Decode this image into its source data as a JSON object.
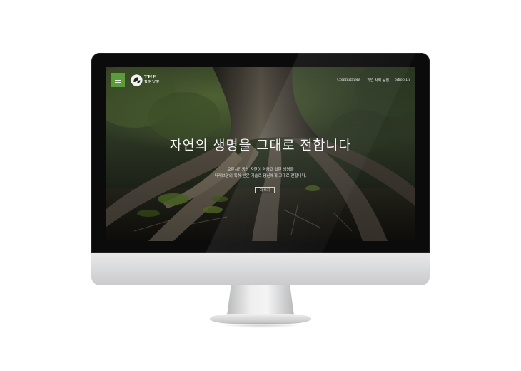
{
  "site": {
    "logo": {
      "line1": "THE",
      "line2": "REVE"
    },
    "nav": [
      "Commitment",
      "기업 사회 공헌",
      "Shop Di"
    ],
    "hero": {
      "title": "자연의 생명을 그대로 전합니다",
      "subtitle_line1": "오랜시간동안 자연이 머금고 있던 생명을",
      "subtitle_line2": "더레브만의 특허 받은 기술로 당신에게 그대로 전합니다.",
      "button": "더 보기"
    }
  },
  "colors": {
    "menu_button": "#5c9b3c",
    "bezel": "#0b0b0b",
    "chin": "#d8d9db"
  },
  "icons": {
    "menu": "hamburger-icon",
    "logo": "leaf-logo-icon"
  }
}
